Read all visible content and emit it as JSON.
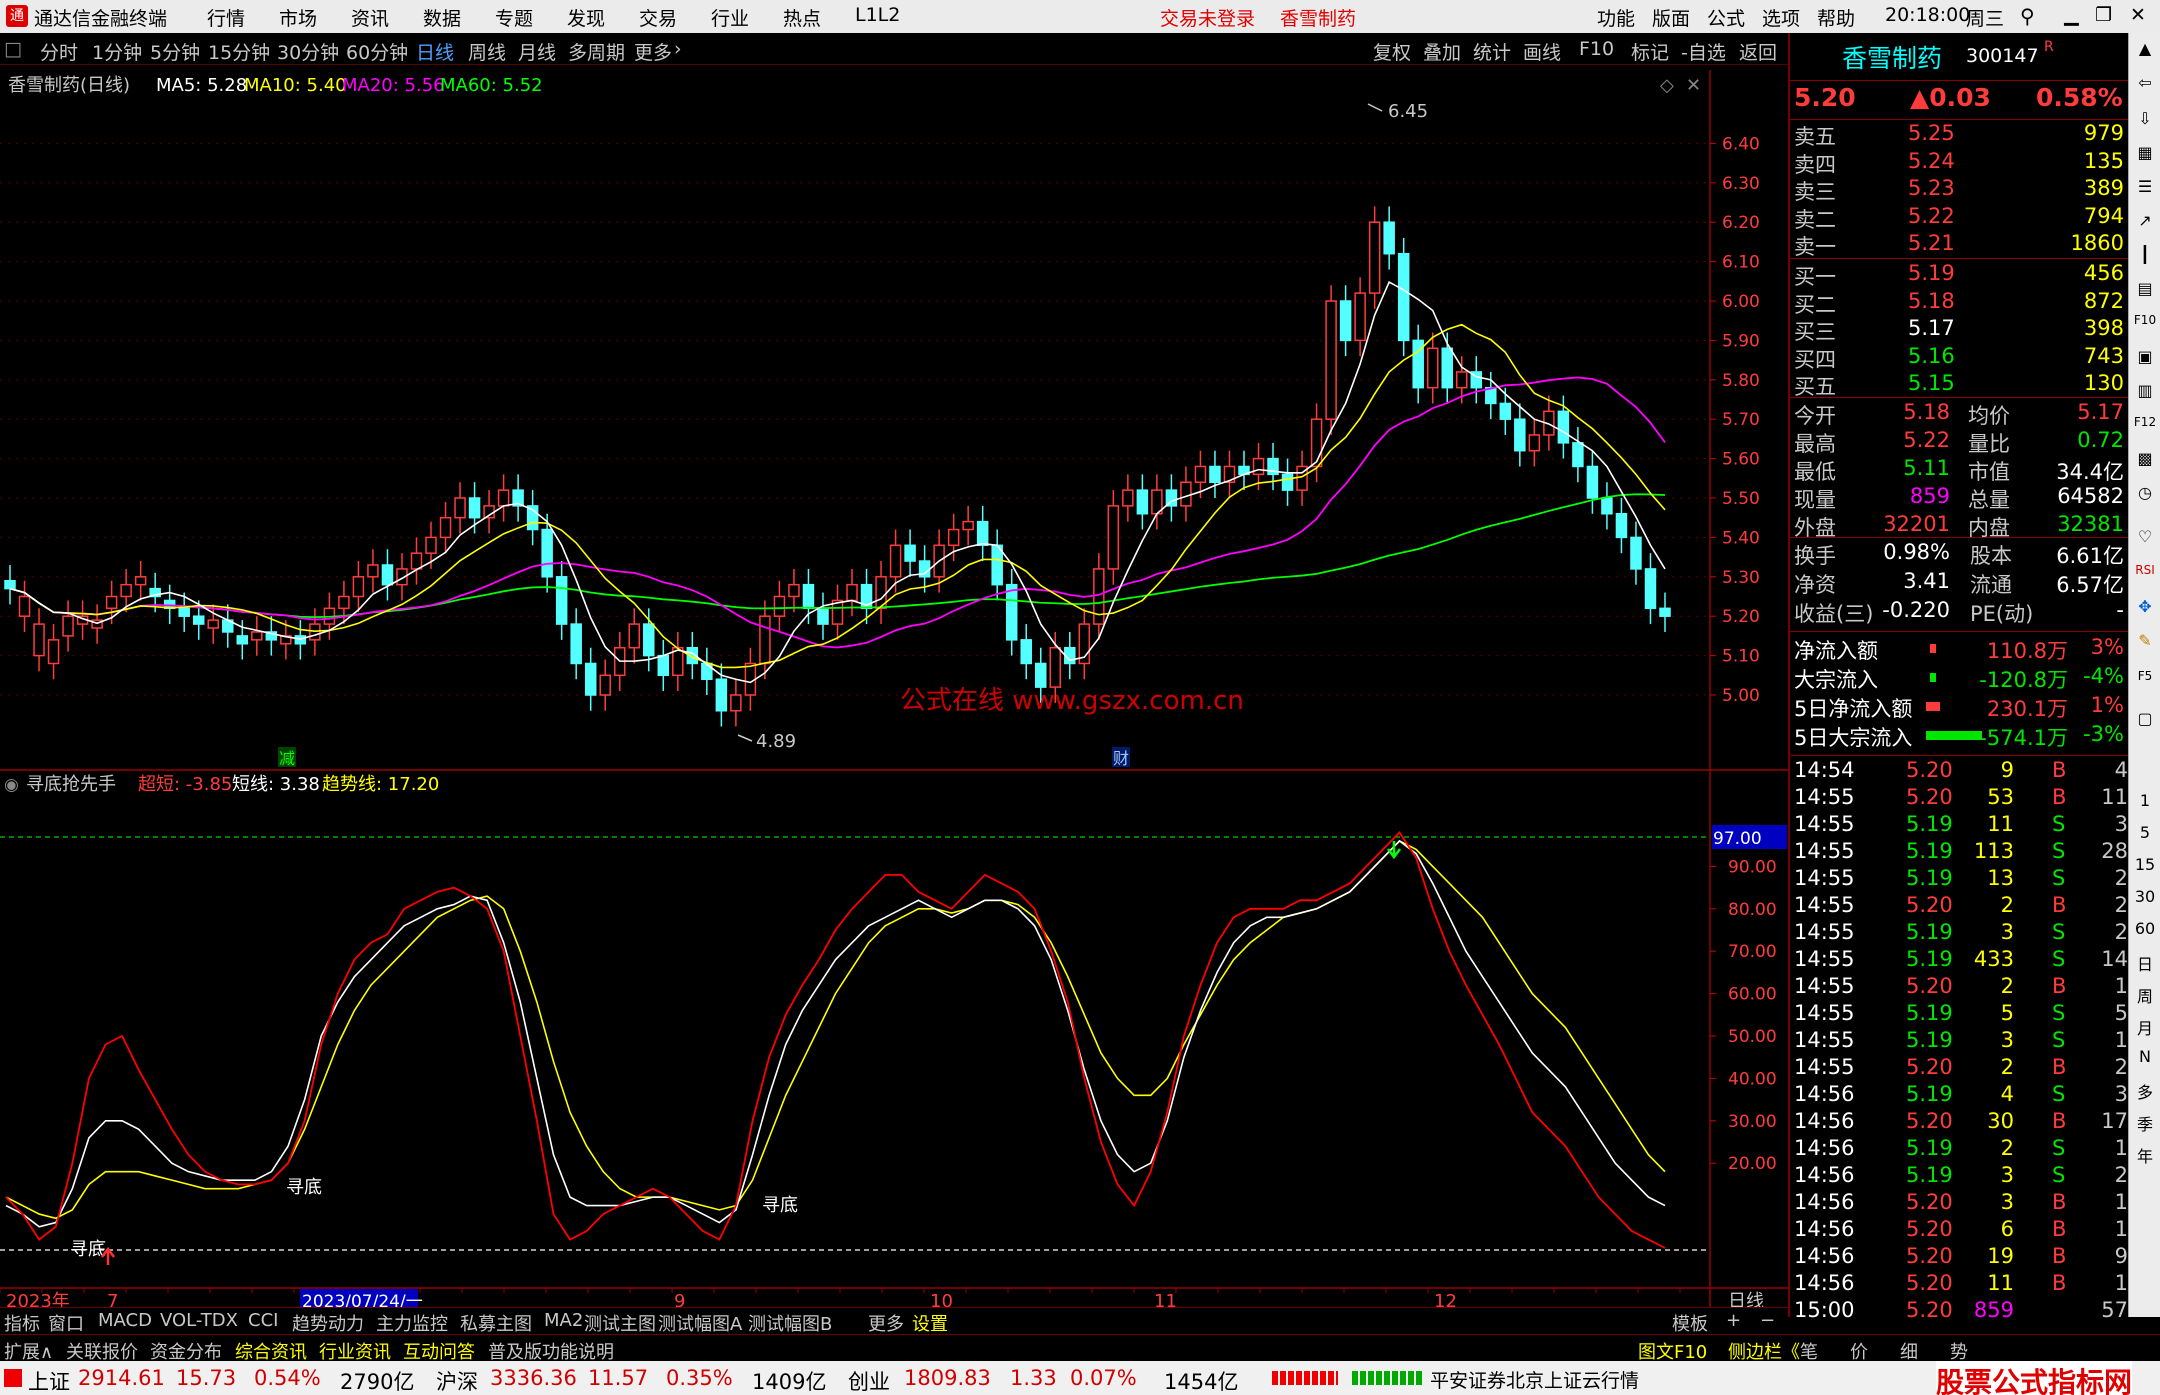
{
  "titlebar": {
    "app_title": "通达信金融终端",
    "menus": [
      "行情",
      "市场",
      "资讯",
      "数据",
      "专题",
      "发现",
      "交易",
      "行业",
      "热点",
      "L1L2"
    ],
    "status_notice": "交易未登录",
    "stock_name": "香雪制药",
    "right_menus": [
      "功能",
      "版面",
      "公式",
      "选项",
      "帮助"
    ],
    "time": "20:18:00",
    "weekday": "周三"
  },
  "periodbar": {
    "periods": [
      "分时",
      "1分钟",
      "5分钟",
      "15分钟",
      "30分钟",
      "60分钟",
      "日线",
      "周线",
      "月线",
      "多周期",
      "更多"
    ],
    "tools": [
      "复权",
      "叠加",
      "统计",
      "画线",
      "F10",
      "标记",
      "-自选",
      "返回"
    ]
  },
  "main_chart": {
    "legend_name": "香雪制药(日线)",
    "ma5": "MA5: 5.28",
    "ma10": "MA10: 5.40",
    "ma20": "MA20: 5.56",
    "ma60": "MA60: 5.52",
    "high_mark": "6.45",
    "low_mark": "4.89",
    "price_ticks": [
      "6.40",
      "6.30",
      "6.20",
      "6.10",
      "6.00",
      "5.90",
      "5.80",
      "5.70",
      "5.60",
      "5.50",
      "5.40",
      "5.30",
      "5.20",
      "5.10",
      "5.00"
    ],
    "watermark": "公式在线  www.gszx.com.cn",
    "tag_reduce": "减",
    "tag_fin": "财"
  },
  "indicator": {
    "name": "寻底抢先手",
    "chaoduan": "超短: -3.85",
    "duanxian": "短线: 3.38",
    "qushi": "趋势线: 17.20",
    "level_label": "97.00",
    "ticks": [
      "90.00",
      "80.00",
      "70.00",
      "60.00",
      "50.00",
      "40.00",
      "30.00",
      "20.00"
    ],
    "signal_labels": [
      "寻底",
      "寻底",
      "寻底"
    ]
  },
  "timeaxis": {
    "labels": [
      "2023年",
      "7",
      "2023/07/24/一",
      "9",
      "10",
      "11",
      "12"
    ],
    "period": "日线"
  },
  "quote": {
    "name": "香雪制药",
    "code": "300147",
    "price": "5.20",
    "change": "▲0.03",
    "pct": "0.58%",
    "asks": [
      {
        "l": "卖五",
        "p": "5.25",
        "v": "979"
      },
      {
        "l": "卖四",
        "p": "5.24",
        "v": "135"
      },
      {
        "l": "卖三",
        "p": "5.23",
        "v": "389"
      },
      {
        "l": "卖二",
        "p": "5.22",
        "v": "794"
      },
      {
        "l": "卖一",
        "p": "5.21",
        "v": "1860"
      }
    ],
    "bids": [
      {
        "l": "买一",
        "p": "5.19",
        "v": "456"
      },
      {
        "l": "买二",
        "p": "5.18",
        "v": "872"
      },
      {
        "l": "买三",
        "p": "5.17",
        "v": "398"
      },
      {
        "l": "买四",
        "p": "5.16",
        "v": "743"
      },
      {
        "l": "买五",
        "p": "5.15",
        "v": "130"
      }
    ],
    "stats": [
      [
        "今开",
        "5.18",
        "均价",
        "5.17"
      ],
      [
        "最高",
        "5.22",
        "量比",
        "0.72"
      ],
      [
        "最低",
        "5.11",
        "市值",
        "34.4亿"
      ],
      [
        "现量",
        "859",
        "总量",
        "64582"
      ],
      [
        "外盘",
        "32201",
        "内盘",
        "32381"
      ]
    ],
    "stats2": [
      [
        "换手",
        "0.98%",
        "股本",
        "6.61亿"
      ],
      [
        "净资",
        "3.41",
        "流通",
        "6.57亿"
      ],
      [
        "收益(三)",
        "-0.220",
        "PE(动)",
        "-"
      ]
    ],
    "flows": [
      [
        "净流入额",
        "110.8万",
        "3%"
      ],
      [
        "大宗流入",
        "-120.8万",
        "-4%"
      ],
      [
        "5日净流入额",
        "230.1万",
        "1%"
      ],
      [
        "5日大宗流入",
        "-574.1万",
        "-3%"
      ]
    ],
    "ticks": [
      [
        "14:54",
        "5.20",
        "9",
        "B",
        "4"
      ],
      [
        "14:55",
        "5.20",
        "53",
        "B",
        "11"
      ],
      [
        "14:55",
        "5.19",
        "11",
        "S",
        "3"
      ],
      [
        "14:55",
        "5.19",
        "113",
        "S",
        "28"
      ],
      [
        "14:55",
        "5.19",
        "13",
        "S",
        "2"
      ],
      [
        "14:55",
        "5.20",
        "2",
        "B",
        "2"
      ],
      [
        "14:55",
        "5.19",
        "3",
        "S",
        "2"
      ],
      [
        "14:55",
        "5.19",
        "433",
        "S",
        "14"
      ],
      [
        "14:55",
        "5.20",
        "2",
        "B",
        "1"
      ],
      [
        "14:55",
        "5.19",
        "5",
        "S",
        "5"
      ],
      [
        "14:55",
        "5.19",
        "3",
        "S",
        "1"
      ],
      [
        "14:55",
        "5.20",
        "2",
        "B",
        "2"
      ],
      [
        "14:56",
        "5.19",
        "4",
        "S",
        "3"
      ],
      [
        "14:56",
        "5.20",
        "30",
        "B",
        "17"
      ],
      [
        "14:56",
        "5.19",
        "2",
        "S",
        "1"
      ],
      [
        "14:56",
        "5.19",
        "3",
        "S",
        "2"
      ],
      [
        "14:56",
        "5.20",
        "3",
        "B",
        "1"
      ],
      [
        "14:56",
        "5.20",
        "6",
        "B",
        "1"
      ],
      [
        "14:56",
        "5.20",
        "19",
        "B",
        "9"
      ],
      [
        "14:56",
        "5.20",
        "11",
        "B",
        "1"
      ],
      [
        "15:00",
        "5.20",
        "859",
        "",
        "57"
      ]
    ]
  },
  "sidebar": {
    "labels": [
      "1",
      "5",
      "15",
      "30",
      "60",
      "日",
      "周",
      "月",
      "N",
      "多",
      "季",
      "年"
    ]
  },
  "indtabs": {
    "tabs": [
      "指标",
      "窗口",
      "MACD",
      "VOL-TDX",
      "CCI",
      "趋势动力",
      "主力监控",
      "私募主图",
      "MA2",
      "测试主图",
      "测试幅图A",
      "测试幅图B",
      "更多",
      "设置"
    ],
    "right": [
      "模板",
      "+",
      "−"
    ]
  },
  "bottomtabs": {
    "left": [
      "扩展∧",
      "关联报价",
      "资金分布",
      "综合资讯",
      "行业资讯",
      "互动问答",
      "普及版功能说明"
    ],
    "right": [
      "图文F10",
      "侧边栏《",
      "笔",
      "价",
      "细",
      "势"
    ]
  },
  "statusbar": {
    "sh_label": "上证",
    "sh_val": "2914.61",
    "sh_chg": "15.73",
    "sh_pct": "0.54%",
    "sh_amt": "2790亿",
    "sz_label": "沪深",
    "sz_val": "3336.36",
    "sz_chg": "11.57",
    "sz_pct": "0.35%",
    "sz_amt": "1409亿",
    "cy_label": "创业",
    "cy_val": "1809.83",
    "cy_chg": "1.33",
    "cy_pct": "0.07%",
    "cy_amt": "1454亿",
    "server": "平安证券北京上证云行情",
    "logo_text": "股票公式指标网",
    "logo_url": "www.gszx.com.cn"
  },
  "colors": {
    "up": "#ff3c3c",
    "down": "#54ffff",
    "ma5": "#ffffff",
    "ma10": "#ffff00",
    "ma20": "#ff00ff",
    "ma60": "#00ff00"
  }
}
